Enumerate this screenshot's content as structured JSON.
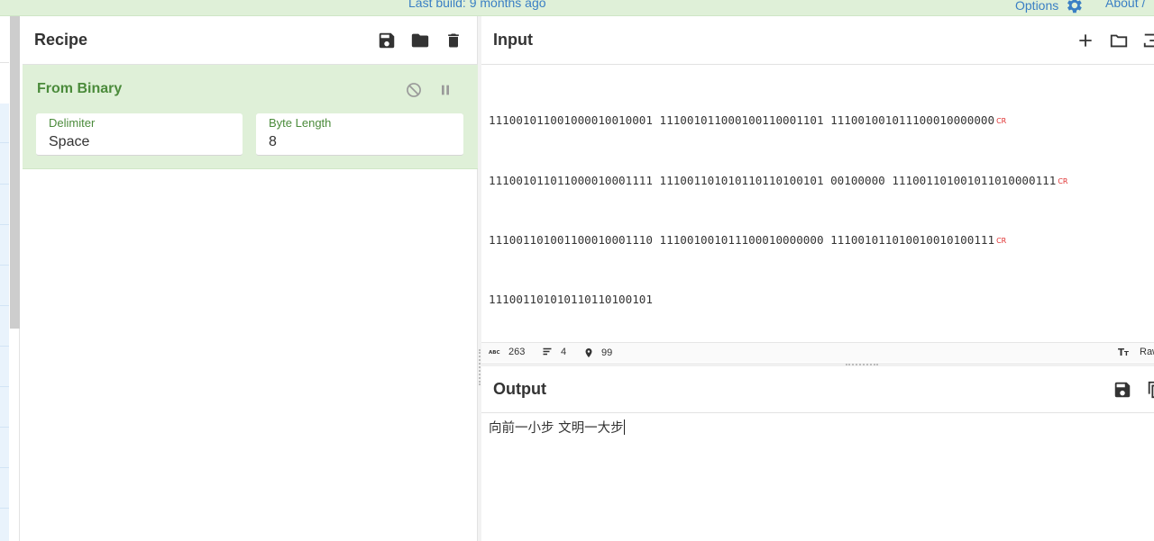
{
  "topbar": {
    "last_build": "Last build: 9 months ago",
    "options_label": "Options",
    "about_label": "About /"
  },
  "recipe": {
    "title": "Recipe",
    "operation": {
      "name": "From Binary",
      "delimiter_label": "Delimiter",
      "delimiter_value": "Space",
      "byte_length_label": "Byte Length",
      "byte_length_value": "8"
    }
  },
  "input": {
    "title": "Input",
    "lines": [
      {
        "text": "111001011001000010010001 111001011000100110001101 111001001011100010000000",
        "cr": "CR"
      },
      {
        "text": "111001011011000010001111 111001101010110110100101 00100000 111001101001011010000111",
        "cr": "CR"
      },
      {
        "text": "111001101001100010001110 111001001011100010000000 111001011010010010100111",
        "cr": "CR"
      },
      {
        "text": "111001101010110110100101",
        "cr": ""
      }
    ],
    "status": {
      "length": "263",
      "lines": "4",
      "position": "99",
      "font_label": "Raw"
    }
  },
  "output": {
    "title": "Output",
    "text": "向前一小步 文明一大步"
  },
  "colors": {
    "accent_green_bg": "#dff0d8",
    "accent_green_text": "#4b8b3b",
    "link_blue": "#3a7fc4",
    "cr_red": "#e03030"
  }
}
